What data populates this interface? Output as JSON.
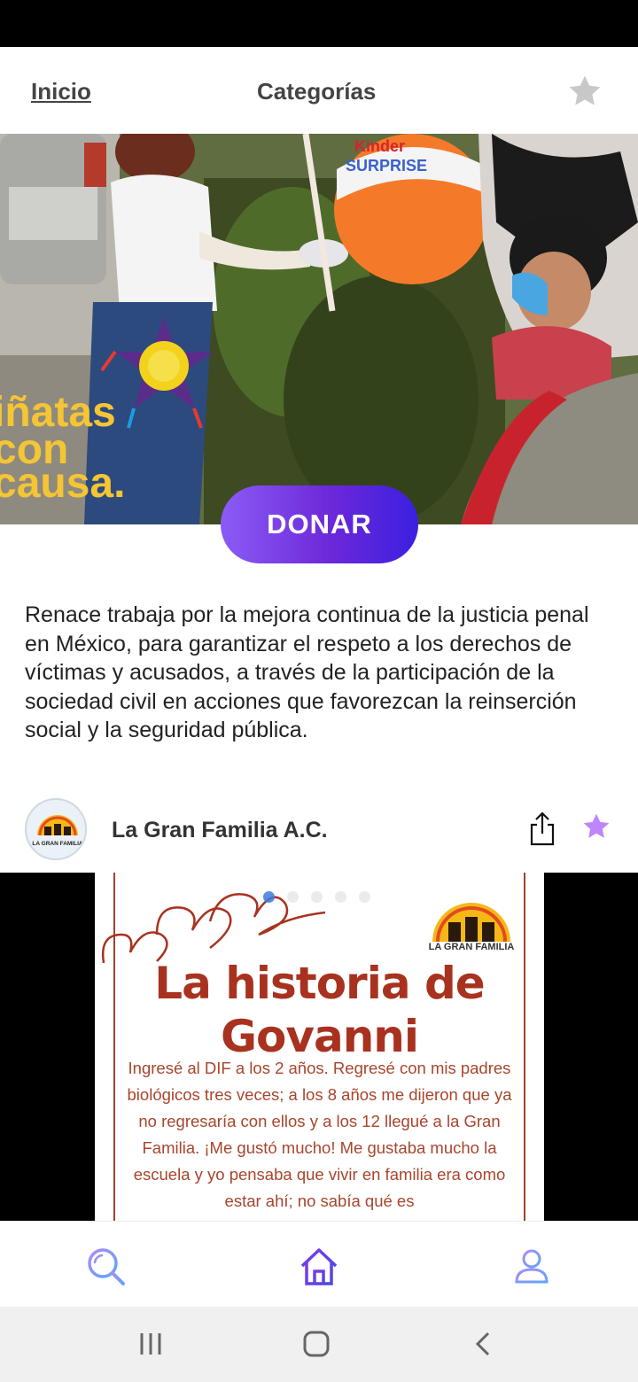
{
  "nav": {
    "home_label": "Inicio",
    "categories_label": "Categorías"
  },
  "hero": {
    "overlay_text": [
      "iñatas",
      "con",
      "causa."
    ],
    "pinata_brand_1": "Kinder",
    "pinata_brand_2": "SURPRISE"
  },
  "donate_label": "DONAR",
  "mission_text": "Renace trabaja por la mejora continua de la justicia penal en México, para garantizar el respeto a los derechos de víctimas y acusados, a través de la participación de la sociedad civil en acciones que favorezcan la reinserción social y la seguridad pública.",
  "organization": {
    "name": "La Gran Familia A.C.",
    "avatar_text": "LA GRAN FAMILIA"
  },
  "post": {
    "logo_text": "LA GRAN FAMILIA",
    "title_line1": "La historia de",
    "title_line2": "Govanni",
    "body": "Ingresé al DIF a los 2 años. Regresé con mis padres biológicos tres veces; a los 8 años me dijeron que ya no regresaría con ellos y a los 12 llegué a la Gran Familia. ¡Me gustó mucho! Me gustaba mucho la escuela y yo pensaba que vivir en familia era como estar ahí; no sabía qué es",
    "carousel_total": 5,
    "carousel_active": 1
  },
  "colors": {
    "accent": "#7c3aed",
    "donate_gradient_start": "#8b5cf6",
    "donate_gradient_end": "#3b20e0",
    "favorite_star": "#c084fc",
    "post_title": "#a8321f"
  },
  "icons": {
    "favorite_header": "star-icon",
    "share": "share-icon",
    "favorite_org": "star-icon",
    "search": "search-icon",
    "home": "home-icon",
    "profile": "profile-icon"
  }
}
